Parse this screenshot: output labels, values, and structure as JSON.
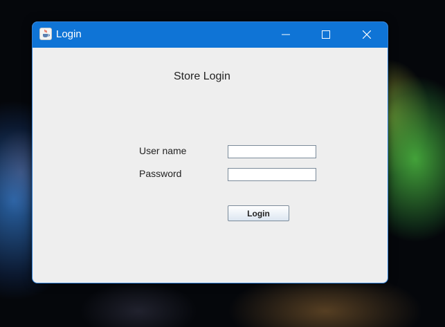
{
  "window": {
    "title": "Login",
    "icon": "java-cup-icon",
    "controls": [
      "minimize-icon",
      "maximize-icon",
      "close-icon"
    ]
  },
  "form": {
    "heading": "Store Login",
    "username_label": "User name",
    "username_value": "",
    "password_label": "Password",
    "password_value": "",
    "login_label": "Login"
  },
  "colors": {
    "titlebar": "#0f74d6",
    "window_background": "#eeeeee",
    "accent_border": "#2f7fd6"
  }
}
